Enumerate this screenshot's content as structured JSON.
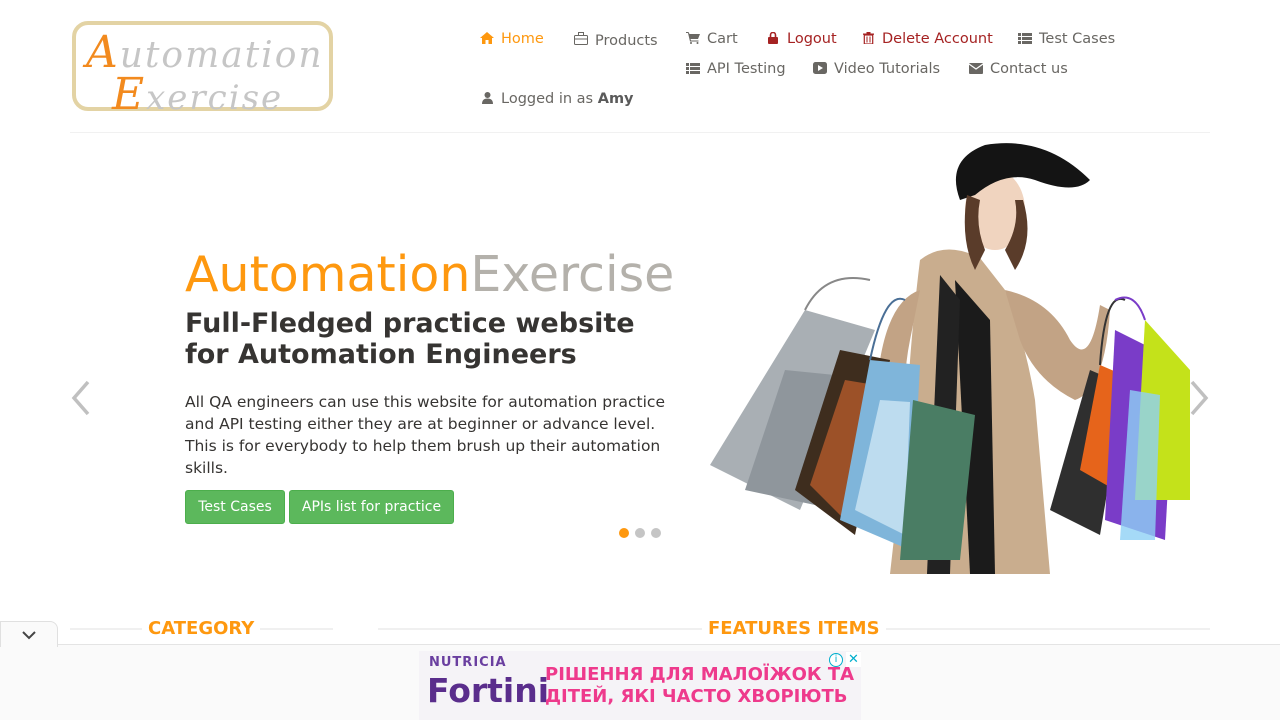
{
  "logo": {
    "line1_cap": "A",
    "line1_rest": "utomation",
    "line2_cap": "E",
    "line2_rest": "xercise"
  },
  "nav": {
    "home": "Home",
    "products": "Products",
    "cart": "Cart",
    "logout": "Logout",
    "delete_account": "Delete Account",
    "test_cases": "Test Cases",
    "api_testing": "API Testing",
    "video_tutorials": "Video Tutorials",
    "contact_us": "Contact us",
    "logged_in_prefix": "Logged in as",
    "logged_in_user": "Amy"
  },
  "hero": {
    "brand_part1": "Automation",
    "brand_part2": "Exercise",
    "title": "Full-Fledged practice website for Automation Engineers",
    "description": "All QA engineers can use this website for automation practice and API testing either they are at beginner or advance level. This is for everybody to help them brush up their automation skills.",
    "button_test_cases": "Test Cases",
    "button_apis": "APIs list for practice",
    "active_slide": 1,
    "slide_count": 3
  },
  "sections": {
    "category": "CATEGORY",
    "features_items": "FEATURES ITEMS"
  },
  "ad": {
    "brand_small": "NUTRICIA",
    "brand": "Fortini",
    "text": "РІШЕННЯ ДЛЯ МАЛОЇЖОК ТА ДІТЕЙ, ЯКІ ЧАСТО ХВОРІЮТЬ",
    "info_glyph": "i",
    "close_glyph": "✕"
  },
  "colors": {
    "accent": "#fe980f",
    "danger": "#a52222",
    "button_green": "#5cb85c",
    "brand_grey": "#b4b1ab"
  }
}
